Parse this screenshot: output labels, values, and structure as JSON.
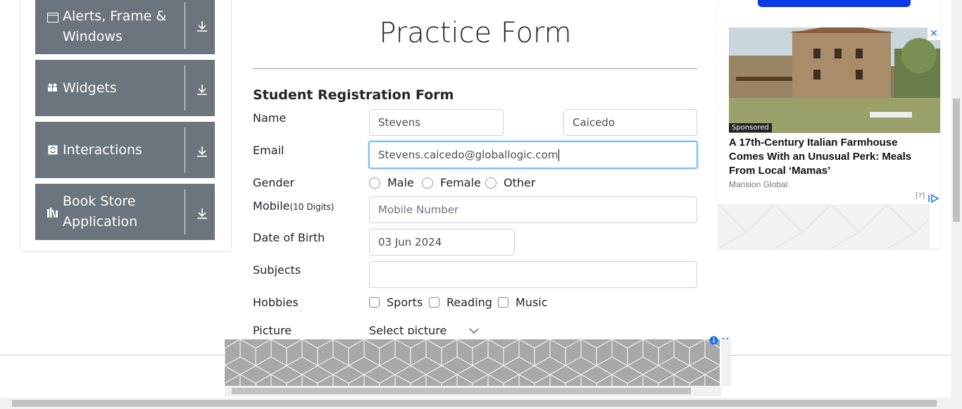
{
  "sidebar": {
    "groups": [
      {
        "label": "Alerts, Frame & Windows",
        "icon": "window-icon"
      },
      {
        "label": "Widgets",
        "icon": "widgets-icon"
      },
      {
        "label": "Interactions",
        "icon": "interactions-icon"
      },
      {
        "label": "Book Store Application",
        "icon": "books-icon"
      }
    ]
  },
  "form": {
    "title": "Practice Form",
    "subtitle": "Student Registration Form",
    "name_label": "Name",
    "first_name": "Stevens",
    "last_name": "Caicedo",
    "email_label": "Email",
    "email": "Stevens.caicedo@globallogic.com",
    "gender_label": "Gender",
    "gender_options": [
      "Male",
      "Female",
      "Other"
    ],
    "mobile_label": "Mobile",
    "mobile_hint": "(10 Digits)",
    "mobile_placeholder": "Mobile Number",
    "dob_label": "Date of Birth",
    "dob": "03 Jun 2024",
    "subjects_label": "Subjects",
    "subjects": "",
    "hobbies_label": "Hobbies",
    "hobbies": [
      "Sports",
      "Reading",
      "Music"
    ],
    "picture_label": "Picture",
    "picture_button": "Select picture"
  },
  "ad_right": {
    "sponsored": "Sponsored",
    "headline": "A 17th-Century Italian Farmhouse Comes With an Unusual Perk: Meals From Local ‘Mamas’",
    "source": "Mansion Global",
    "help": "[?]",
    "close": "✕"
  },
  "colors": {
    "sidebar_bg": "#6c757d",
    "focus_border": "#80bdff",
    "ad_button": "#0b3ae6"
  }
}
